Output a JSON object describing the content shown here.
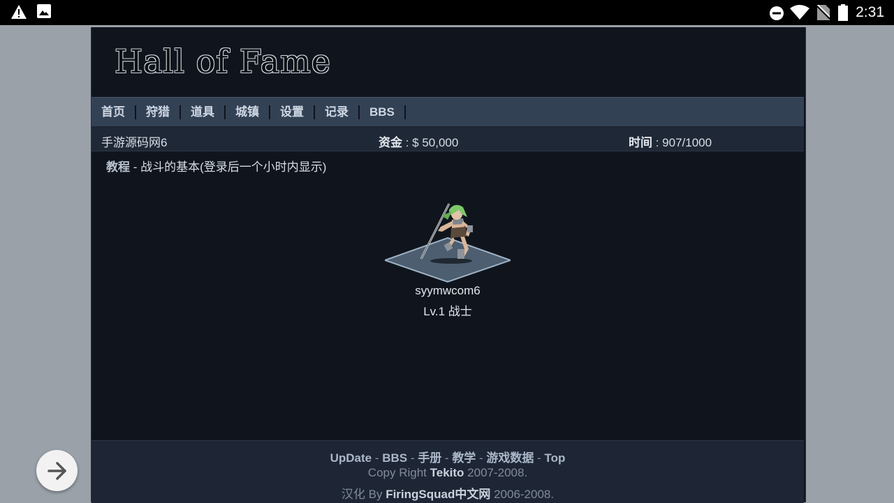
{
  "statusbar": {
    "time": "2:31"
  },
  "site": {
    "title": "Hall of Fame"
  },
  "nav": [
    "首页",
    "狩猎",
    "道具",
    "城镇",
    "设置",
    "记录",
    "BBS"
  ],
  "info": {
    "user": "手游源码网6",
    "money_label": "资金",
    "money_value": " : $ 50,000",
    "time_label": "时间",
    "time_value": " : 907/1000"
  },
  "tutorial": {
    "link": "教程",
    "text": " - 战斗的基本(登录后一个小时内显示)"
  },
  "character": {
    "name": "syymwcom6",
    "level": "Lv.1 战士"
  },
  "footer": {
    "links": [
      "UpDate",
      "BBS",
      "手册",
      "教学",
      "游戏数据",
      "Top"
    ],
    "sep": " - ",
    "copyright_prefix": "Copy Right ",
    "copyright_author": "Tekito",
    "copyright_years": " 2007-2008.",
    "l10n_prefix": "汉化 By ",
    "l10n_author": "FiringSquad中文网",
    "l10n_years": " 2006-2008."
  }
}
